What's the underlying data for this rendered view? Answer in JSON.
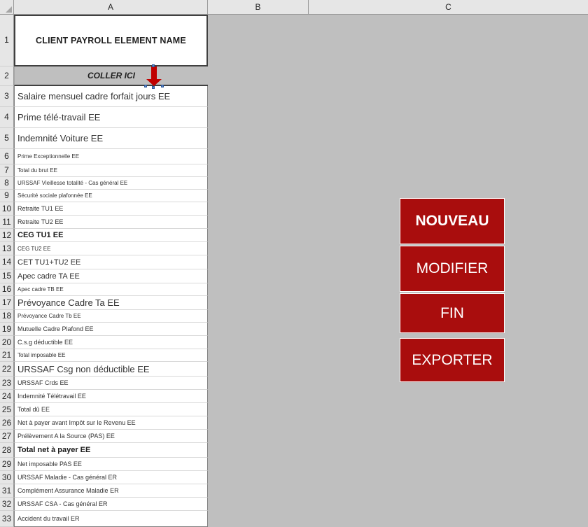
{
  "window": {
    "app": "spreadsheet",
    "title": "CLIENT PAYROLL ELEMENT NAME"
  },
  "colors": {
    "button_red": "#A90D0D",
    "sheet_grey": "#BFBFBF",
    "header_grey": "#E6E6E6",
    "arrow_red": "#C00000"
  },
  "columns": [
    {
      "label": "A"
    },
    {
      "label": "B"
    },
    {
      "label": "C"
    }
  ],
  "cells": {
    "a1_title": "CLIENT PAYROLL ELEMENT NAME",
    "a2_paste_here": "COLLER ICI"
  },
  "icons": {
    "select_all": "select-all-corner-icon",
    "paste_arrow": "down-arrow-icon"
  },
  "rows": [
    {
      "num": "1",
      "text": "CLIENT PAYROLL ELEMENT NAME"
    },
    {
      "num": "2",
      "text": "COLLER ICI"
    },
    {
      "num": "3",
      "text": "Salaire mensuel cadre forfait jours EE"
    },
    {
      "num": "4",
      "text": "Prime télé-travail EE"
    },
    {
      "num": "5",
      "text": "Indemnité Voiture EE"
    },
    {
      "num": "6",
      "text": "Prime Exceptionnelle EE"
    },
    {
      "num": "7",
      "text": "Total du brut EE"
    },
    {
      "num": "8",
      "text": "URSSAF Vieillesse totalité - Cas général EE"
    },
    {
      "num": "9",
      "text": "Sécurité sociale plafonnée EE"
    },
    {
      "num": "10",
      "text": "Retraite TU1 EE"
    },
    {
      "num": "11",
      "text": "Retraite TU2 EE"
    },
    {
      "num": "12",
      "text": "CEG TU1 EE"
    },
    {
      "num": "13",
      "text": "CEG TU2 EE"
    },
    {
      "num": "14",
      "text": "CET TU1+TU2 EE"
    },
    {
      "num": "15",
      "text": "Apec cadre TA EE"
    },
    {
      "num": "16",
      "text": "Apec cadre TB EE"
    },
    {
      "num": "17",
      "text": "Prévoyance Cadre Ta EE"
    },
    {
      "num": "18",
      "text": "Prévoyance Cadre Tb EE"
    },
    {
      "num": "19",
      "text": "Mutuelle Cadre Plafond EE"
    },
    {
      "num": "20",
      "text": "C.s.g déductible EE"
    },
    {
      "num": "21",
      "text": "Total imposable EE"
    },
    {
      "num": "22",
      "text": "URSSAF Csg non déductible EE"
    },
    {
      "num": "23",
      "text": "URSSAF Crds EE"
    },
    {
      "num": "24",
      "text": "Indemnité Télétravail EE"
    },
    {
      "num": "25",
      "text": "Total dû EE"
    },
    {
      "num": "26",
      "text": "Net à payer avant Impôt sur le Revenu EE"
    },
    {
      "num": "27",
      "text": "Prélèvement A la Source (PAS) EE"
    },
    {
      "num": "28",
      "text": "Total net à payer EE"
    },
    {
      "num": "29",
      "text": "Net imposable PAS EE"
    },
    {
      "num": "30",
      "text": "URSSAF Maladie - Cas général ER"
    },
    {
      "num": "31",
      "text": "Complément Assurance Maladie ER"
    },
    {
      "num": "32",
      "text": "URSSAF CSA - Cas général ER"
    },
    {
      "num": "33",
      "text": "Accident du travail ER"
    }
  ],
  "buttons": {
    "nouveau": "NOUVEAU",
    "modifier": "MODIFIER",
    "fin": "FIN",
    "exporter": "EXPORTER"
  }
}
